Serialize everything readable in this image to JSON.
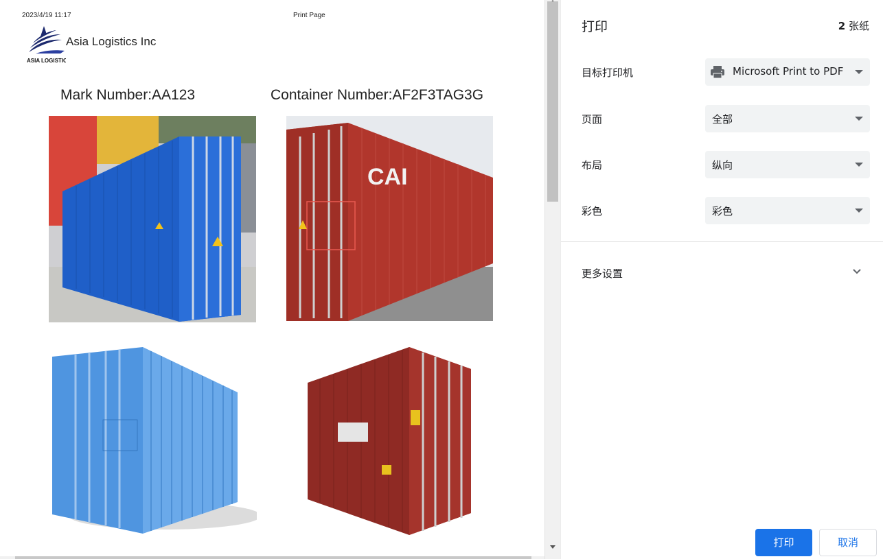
{
  "preview": {
    "header_date": "2023/4/19 11:17",
    "header_title": "Print Page",
    "logo_caption": "ASIA LOGISTICS",
    "company_name": "Asia Logistics Inc",
    "mark_number": "Mark Number:AA123",
    "container_number": "Container Number:AF2F3TAG3G",
    "photos": [
      {
        "name": "blue-container-photo-1",
        "color": "#1f5fc8"
      },
      {
        "name": "red-container-photo-1",
        "color": "#b1362c"
      },
      {
        "name": "blue-container-photo-2",
        "color": "#4f95e0"
      },
      {
        "name": "red-container-photo-2",
        "color": "#8f2a24"
      }
    ]
  },
  "panel": {
    "title": "打印",
    "sheet_count": "2",
    "sheet_unit": "张纸",
    "rows": [
      {
        "label": "目标打印机",
        "value": "Microsoft Print to PDF",
        "icon": "printer-icon"
      },
      {
        "label": "页面",
        "value": "全部"
      },
      {
        "label": "布局",
        "value": "纵向"
      },
      {
        "label": "彩色",
        "value": "彩色"
      }
    ],
    "more_settings": "更多设置",
    "print_button": "打印",
    "cancel_button": "取消"
  },
  "colors": {
    "accent": "#1a73e8",
    "select_bg": "#f1f3f4"
  }
}
